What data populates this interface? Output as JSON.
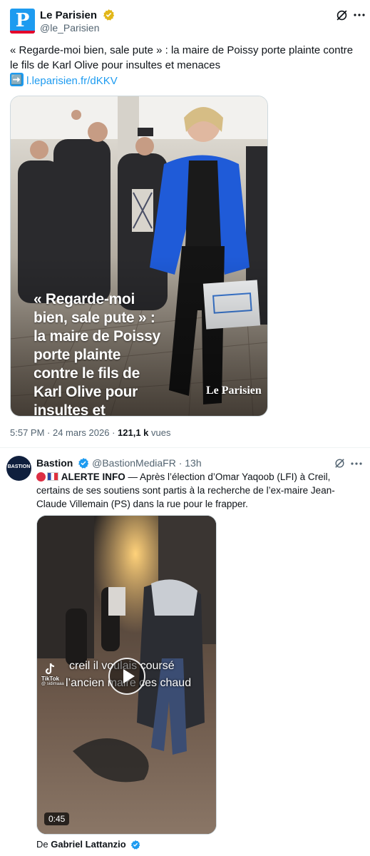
{
  "tweet1": {
    "account_name": "Le Parisien",
    "handle": "@le_Parisien",
    "text": "« Regarde-moi bien, sale pute » : la maire de Poissy porte plainte contre le fils de Karl Olive pour insultes et menaces",
    "link_emoji": "➡️",
    "link": "l.leparisien.fr/dKKV",
    "image_overlay_text": "« Regarde-moi bien, sale pute » : la maire de Poissy porte plainte contre le fils de Karl Olive pour insultes et menaces",
    "image_watermark": "Le Parisien",
    "time": "5:57 PM · 24 mars 2026 · ",
    "views_count": "121,1 k",
    "views_label": " vues",
    "badge_color": "#e2b719",
    "logo_letter": "P"
  },
  "tweet2": {
    "account_name": "Bastion",
    "handle": "@BastionMediaFR",
    "time": "· 13h",
    "alert_label": "ALERTE INFO",
    "text_after_label": " — Après l’élection d’Omar Yaqoob (LFI) à Creil, certains de ses soutiens sont partis à la recherche de l’ex-maire Jean-Claude Villemain (PS) dans la rue pour le frapper.",
    "video_caption_line1": "creil il voulais coursé",
    "video_caption_line2": "l’ancien maire ces chaud",
    "tiktok_label": "TikTok",
    "tiktok_handle": "@ sidimaaa",
    "duration": "0:45",
    "credit_prefix": "De ",
    "credit_name": "Gabriel Lattanzio",
    "avatar_text": "BASTION",
    "badge_color": "#1d9bf0"
  },
  "colors": {
    "accent": "#1d9bf0",
    "muted": "#536471",
    "gold": "#e2b719"
  },
  "icons": [
    "grok-icon",
    "more-icon",
    "verified-badge-icon",
    "arrow-right-emoji",
    "play-icon",
    "tiktok-icon"
  ]
}
